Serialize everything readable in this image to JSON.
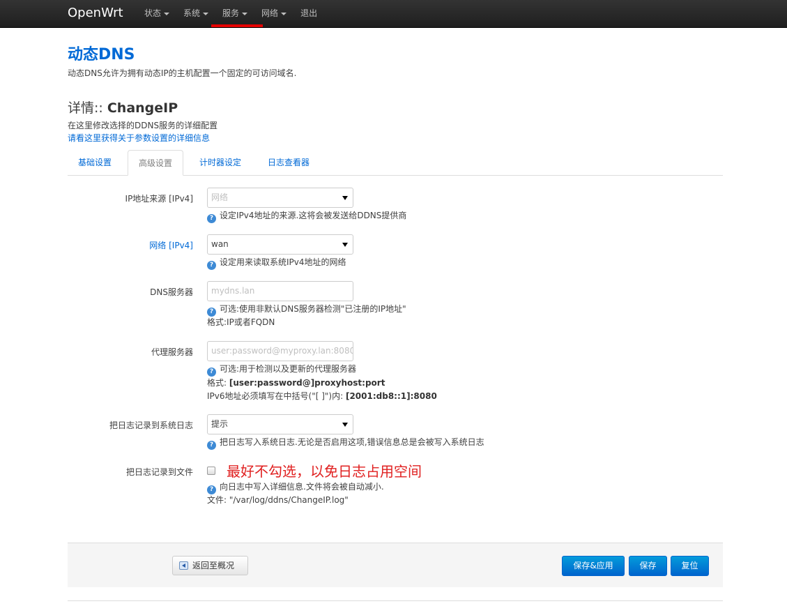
{
  "brand": "OpenWrt",
  "nav": {
    "status": "状态",
    "system": "系统",
    "services": "服务",
    "network": "网络",
    "logout": "退出"
  },
  "page": {
    "title": "动态DNS",
    "description": "动态DNS允许为拥有动态IP的主机配置一个固定的可访问域名."
  },
  "detail": {
    "prefix": "详情:: ",
    "name": "ChangeIP",
    "description": "在这里修改选择的DDNS服务的详细配置",
    "link": "请看这里获得关于参数设置的详细信息"
  },
  "tabs": {
    "basic": "基础设置",
    "advanced": "高级设置",
    "timer": "计时器设定",
    "log_viewer": "日志查看器"
  },
  "fields": {
    "ip_source": {
      "label": "IP地址来源 [IPv4]",
      "value": "网络",
      "help": "设定IPv4地址的来源.这将会被发送给DDNS提供商"
    },
    "network": {
      "label": "网络 [IPv4]",
      "value": "wan",
      "help": "设定用来读取系统IPv4地址的网络"
    },
    "dns_server": {
      "label": "DNS服务器",
      "placeholder": "mydns.lan",
      "help": "可选:使用非默认DNS服务器检测\"已注册的IP地址\"",
      "format": "格式:IP或者FQDN"
    },
    "proxy": {
      "label": "代理服务器",
      "placeholder": "user:password@myproxy.lan:8080",
      "help": "可选:用于检测以及更新的代理服务器",
      "format_prefix": "格式: ",
      "format_value": "[user:password@]proxyhost:port",
      "ipv6_prefix": "IPv6地址必须填写在中括号(\"[ ]\")内: ",
      "ipv6_value": "[2001:db8::1]:8080"
    },
    "syslog": {
      "label": "把日志记录到系统日志",
      "value": "提示",
      "help": "把日志写入系统日志.无论是否启用这项,错误信息总是会被写入系统日志"
    },
    "logfile": {
      "label": "把日志记录到文件",
      "checked": false,
      "annotation": "最好不勾选，以免日志占用空间",
      "help": "向日志中写入详细信息.文件将会被自动减小.",
      "file": "文件: \"/var/log/ddns/ChangeIP.log\""
    }
  },
  "footer": {
    "back": "返回至概况",
    "save_apply": "保存&应用",
    "save": "保存",
    "reset": "复位"
  }
}
